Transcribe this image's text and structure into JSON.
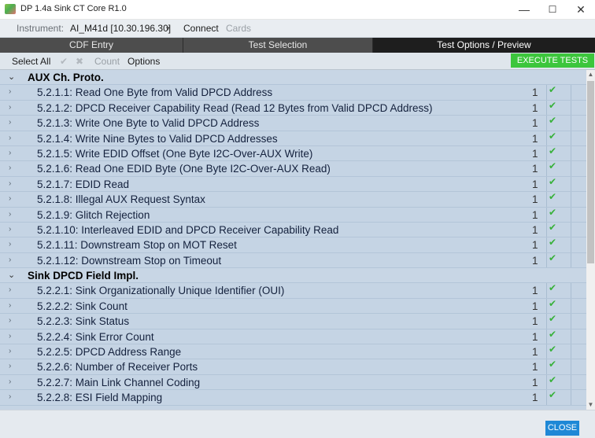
{
  "window": {
    "title": "DP 1.4a Sink CT Core R1.0",
    "minimize_icon": "—",
    "maximize_icon": "☐",
    "close_icon": "✕"
  },
  "instrument": {
    "label": "Instrument:",
    "value": "AI_M41d [10.30.196.30]",
    "dropdown_icon": "▾",
    "connect_label": "Connect",
    "cards_label": "Cards"
  },
  "tabs": [
    {
      "label": "CDF Entry"
    },
    {
      "label": "Test Selection"
    },
    {
      "label": "Test Options / Preview"
    }
  ],
  "toolbar": {
    "select_all": "Select All",
    "check_icon": "✔",
    "x_icon": "✖",
    "count": "Count",
    "options": "Options",
    "execute": "EXECUTE TESTS"
  },
  "groups": [
    {
      "name": "AUX Ch. Proto.",
      "tests": [
        {
          "label": "5.2.1.1: Read One Byte from Valid DPCD Address",
          "count": "1"
        },
        {
          "label": "5.2.1.2: DPCD Receiver Capability Read (Read 12 Bytes from Valid DPCD Address)",
          "count": "1"
        },
        {
          "label": "5.2.1.3: Write One Byte to Valid DPCD Address",
          "count": "1"
        },
        {
          "label": "5.2.1.4: Write Nine Bytes to Valid DPCD Addresses",
          "count": "1"
        },
        {
          "label": "5.2.1.5: Write EDID Offset (One Byte I2C-Over-AUX Write)",
          "count": "1"
        },
        {
          "label": "5.2.1.6: Read One EDID Byte (One Byte I2C-Over-AUX Read)",
          "count": "1"
        },
        {
          "label": "5.2.1.7: EDID Read",
          "count": "1"
        },
        {
          "label": "5.2.1.8: Illegal AUX Request Syntax",
          "count": "1"
        },
        {
          "label": "5.2.1.9: Glitch Rejection",
          "count": "1"
        },
        {
          "label": "5.2.1.10: Interleaved EDID and DPCD Receiver Capability Read",
          "count": "1"
        },
        {
          "label": "5.2.1.11: Downstream Stop on MOT Reset",
          "count": "1"
        },
        {
          "label": "5.2.1.12: Downstream Stop on Timeout",
          "count": "1"
        }
      ]
    },
    {
      "name": "Sink DPCD Field Impl.",
      "tests": [
        {
          "label": "5.2.2.1: Sink Organizationally Unique Identifier (OUI)",
          "count": "1"
        },
        {
          "label": "5.2.2.2: Sink Count",
          "count": "1"
        },
        {
          "label": "5.2.2.3: Sink Status",
          "count": "1"
        },
        {
          "label": "5.2.2.4: Sink Error Count",
          "count": "1"
        },
        {
          "label": "5.2.2.5: DPCD Address Range",
          "count": "1"
        },
        {
          "label": "5.2.2.6: Number of Receiver Ports",
          "count": "1"
        },
        {
          "label": "5.2.2.7: Main Link Channel Coding",
          "count": "1"
        },
        {
          "label": "5.2.2.8: ESI Field Mapping",
          "count": "1"
        }
      ]
    }
  ],
  "icons": {
    "collapse": "⌄",
    "expand": "›",
    "check": "✔"
  },
  "footer": {
    "close": "CLOSE"
  },
  "colors": {
    "execute_button": "#3cc63c",
    "close_button": "#1e88d6",
    "list_background": "#c5d4e4",
    "check_green": "#38b13a"
  }
}
